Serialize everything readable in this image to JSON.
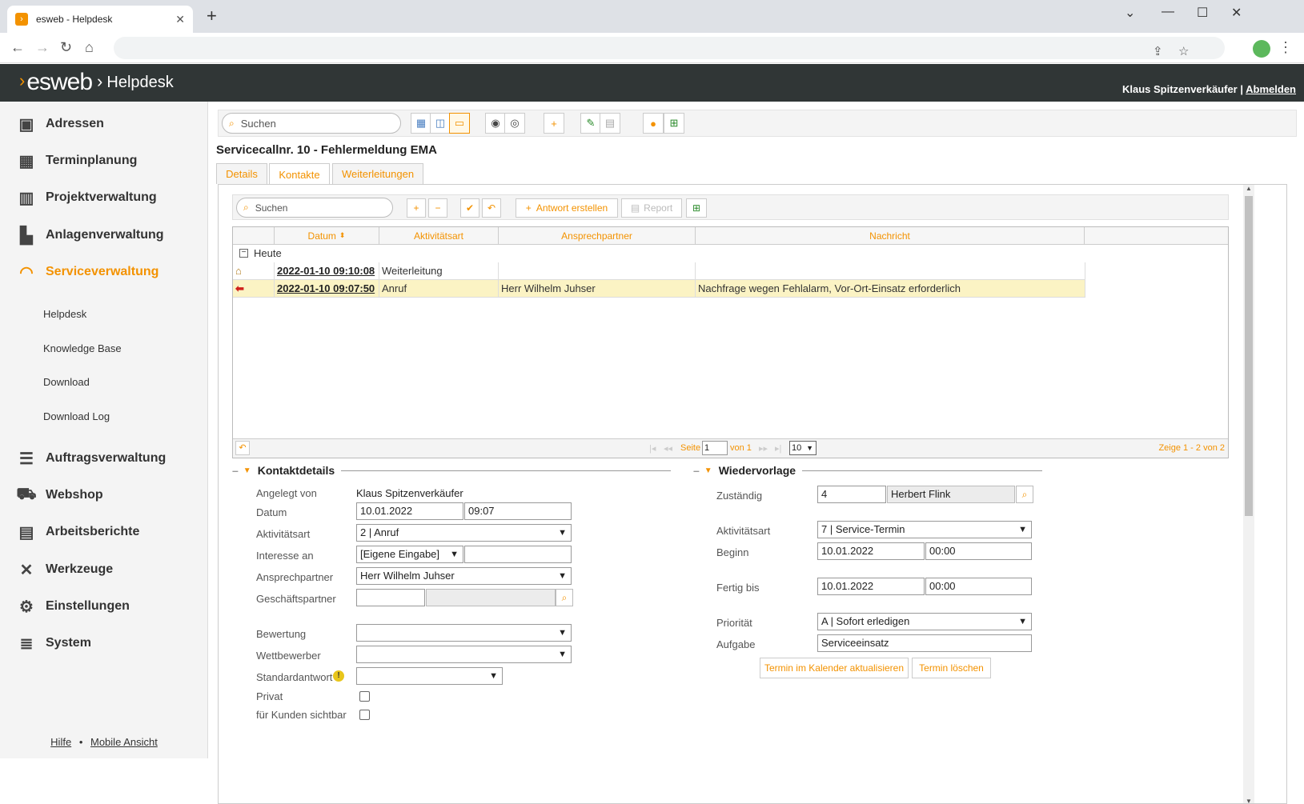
{
  "browser": {
    "tab_title": "esweb - Helpdesk",
    "new_tab": "+",
    "close_tab": "✕"
  },
  "app": {
    "logo_text": "esweb",
    "logo_sep": "›",
    "module": "Helpdesk",
    "user": "Klaus Spitzenverkäufer",
    "separator": "|",
    "logout": "Abmelden"
  },
  "sidebar": {
    "items": [
      {
        "label": "Adressen",
        "icon": "address-book-icon"
      },
      {
        "label": "Terminplanung",
        "icon": "calendar-icon"
      },
      {
        "label": "Projektverwaltung",
        "icon": "project-icon"
      },
      {
        "label": "Anlagenverwaltung",
        "icon": "factory-icon"
      },
      {
        "label": "Serviceverwaltung",
        "icon": "headset-icon",
        "active": true
      },
      {
        "label": "Auftragsverwaltung",
        "icon": "list-icon"
      },
      {
        "label": "Webshop",
        "icon": "cart-icon"
      },
      {
        "label": "Arbeitsberichte",
        "icon": "clipboard-icon"
      },
      {
        "label": "Werkzeuge",
        "icon": "tools-icon"
      },
      {
        "label": "Einstellungen",
        "icon": "gear-icon"
      },
      {
        "label": "System",
        "icon": "database-icon"
      }
    ],
    "subitems": [
      "Helpdesk",
      "Knowledge Base",
      "Download",
      "Download Log"
    ],
    "footer": {
      "help": "Hilfe",
      "dot": "•",
      "mobile": "Mobile Ansicht"
    }
  },
  "toolbar": {
    "search_placeholder": "Suchen"
  },
  "page": {
    "title": "Servicecallnr. 10 - Fehlermeldung EMA",
    "tabs": [
      "Details",
      "Kontakte",
      "Weiterleitungen"
    ],
    "active_tab": "Kontakte"
  },
  "contacts": {
    "search_placeholder": "Suchen",
    "answer_button": "Antwort erstellen",
    "report_button": "Report",
    "columns": [
      "Datum",
      "Aktivitätsart",
      "Ansprechpartner",
      "Nachricht"
    ],
    "group": "Heute",
    "rows": [
      {
        "datum": "2022-01-10 09:10:08",
        "art": "Weiterleitung",
        "partner": "",
        "nachricht": "",
        "icon": "home-icon"
      },
      {
        "datum": "2022-01-10 09:07:50",
        "art": "Anruf",
        "partner": "Herr Wilhelm Juhser",
        "nachricht": "Nachfrage wegen Fehlalarm, Vor-Ort-Einsatz erforderlich",
        "icon": "arrow-left-icon"
      }
    ],
    "pager": {
      "page_label": "Seite",
      "page": "1",
      "of": "von 1",
      "page_size": "10",
      "summary": "Zeige 1 - 2 von 2"
    }
  },
  "kontaktdetails": {
    "title": "Kontaktdetails",
    "angelegt_label": "Angelegt von",
    "angelegt_value": "Klaus Spitzenverkäufer",
    "datum_label": "Datum",
    "datum_date": "10.01.2022",
    "datum_time": "09:07",
    "aktivitaet_label": "Aktivitätsart",
    "aktivitaet_value": "2 | Anruf",
    "interesse_label": "Interesse an",
    "interesse_value": "[Eigene Eingabe]",
    "ansprech_label": "Ansprechpartner",
    "ansprech_value": "Herr Wilhelm Juhser",
    "geschaeft_label": "Geschäftspartner",
    "bewertung_label": "Bewertung",
    "wettbewerber_label": "Wettbewerber",
    "standard_label": "Standardantwort",
    "privat_label": "Privat",
    "sichtbar_label": "für Kunden sichtbar"
  },
  "wiedervorlage": {
    "title": "Wiedervorlage",
    "zustaendig_label": "Zuständig",
    "zustaendig_id": "4",
    "zustaendig_name": "Herbert Flink",
    "aktivitaet_label": "Aktivitätsart",
    "aktivitaet_value": "7 | Service-Termin",
    "beginn_label": "Beginn",
    "beginn_date": "10.01.2022",
    "beginn_time": "00:00",
    "fertig_label": "Fertig bis",
    "fertig_date": "10.01.2022",
    "fertig_time": "00:00",
    "prioritaet_label": "Priorität",
    "prioritaet_value": "A | Sofort erledigen",
    "aufgabe_label": "Aufgabe",
    "aufgabe_value": "Serviceeinsatz",
    "update_button": "Termin im Kalender aktualisieren",
    "delete_button": "Termin löschen"
  },
  "colors": {
    "accent": "#f39200",
    "appbar": "#303636",
    "selected_row": "#fbf3c4"
  }
}
